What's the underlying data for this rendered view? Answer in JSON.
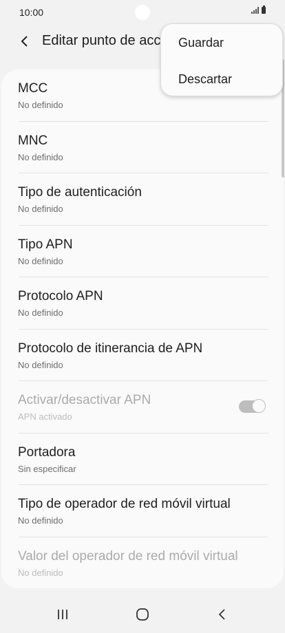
{
  "status_bar": {
    "time": "10:00"
  },
  "header": {
    "title": "Editar punto de acc"
  },
  "menu": {
    "save_label": "Guardar",
    "discard_label": "Descartar"
  },
  "settings": [
    {
      "title": "MCC",
      "subtitle": "No definido",
      "disabled": false
    },
    {
      "title": "MNC",
      "subtitle": "No definido",
      "disabled": false
    },
    {
      "title": "Tipo de autenticación",
      "subtitle": "No definido",
      "disabled": false
    },
    {
      "title": "Tipo APN",
      "subtitle": "No definido",
      "disabled": false
    },
    {
      "title": "Protocolo APN",
      "subtitle": "No definido",
      "disabled": false
    },
    {
      "title": "Protocolo de itinerancia de APN",
      "subtitle": "No definido",
      "disabled": false
    },
    {
      "title": "Activar/desactivar APN",
      "subtitle": "APN activado",
      "disabled": true,
      "toggle_on": true
    },
    {
      "title": "Portadora",
      "subtitle": "Sin especificar",
      "disabled": false
    },
    {
      "title": "Tipo de operador de red móvil virtual",
      "subtitle": "No definido",
      "disabled": false
    },
    {
      "title": "Valor del operador de red móvil virtual",
      "subtitle": "No definido",
      "disabled": true
    }
  ],
  "icons": {
    "back": "chevron-left-icon",
    "recents": "recent-apps-icon",
    "home": "home-icon",
    "nav_back": "nav-back-icon"
  },
  "colors": {
    "background": "#f2f2f2",
    "card": "#fafafa",
    "disabled_text": "#aaaaaa"
  }
}
